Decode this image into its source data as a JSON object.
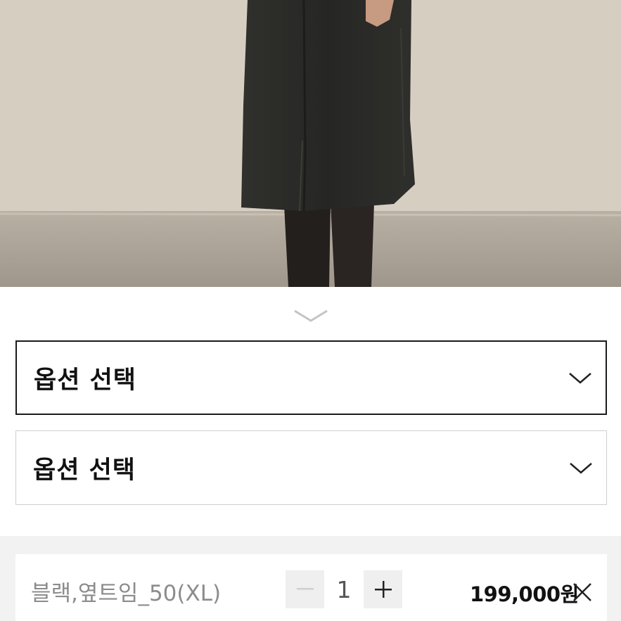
{
  "product_image": {
    "name": "coat-photo",
    "colors": {
      "wall": "#d6cdc1",
      "floor": "#a8a095",
      "garment": "#2b2b29"
    }
  },
  "expand_toggle": {
    "icon": "chevron-down-icon"
  },
  "options": [
    {
      "label": "옵션 선택",
      "state": "active",
      "icon": "chevron-down-icon"
    },
    {
      "label": "옵션 선택",
      "state": "idle",
      "icon": "chevron-down-icon"
    }
  ],
  "selected_item": {
    "name": "블랙,옆트임_50(XL)",
    "quantity": "1",
    "decrement_icon": "minus-icon",
    "increment_icon": "plus-icon",
    "price": "199,000원",
    "remove_icon": "close-icon"
  }
}
